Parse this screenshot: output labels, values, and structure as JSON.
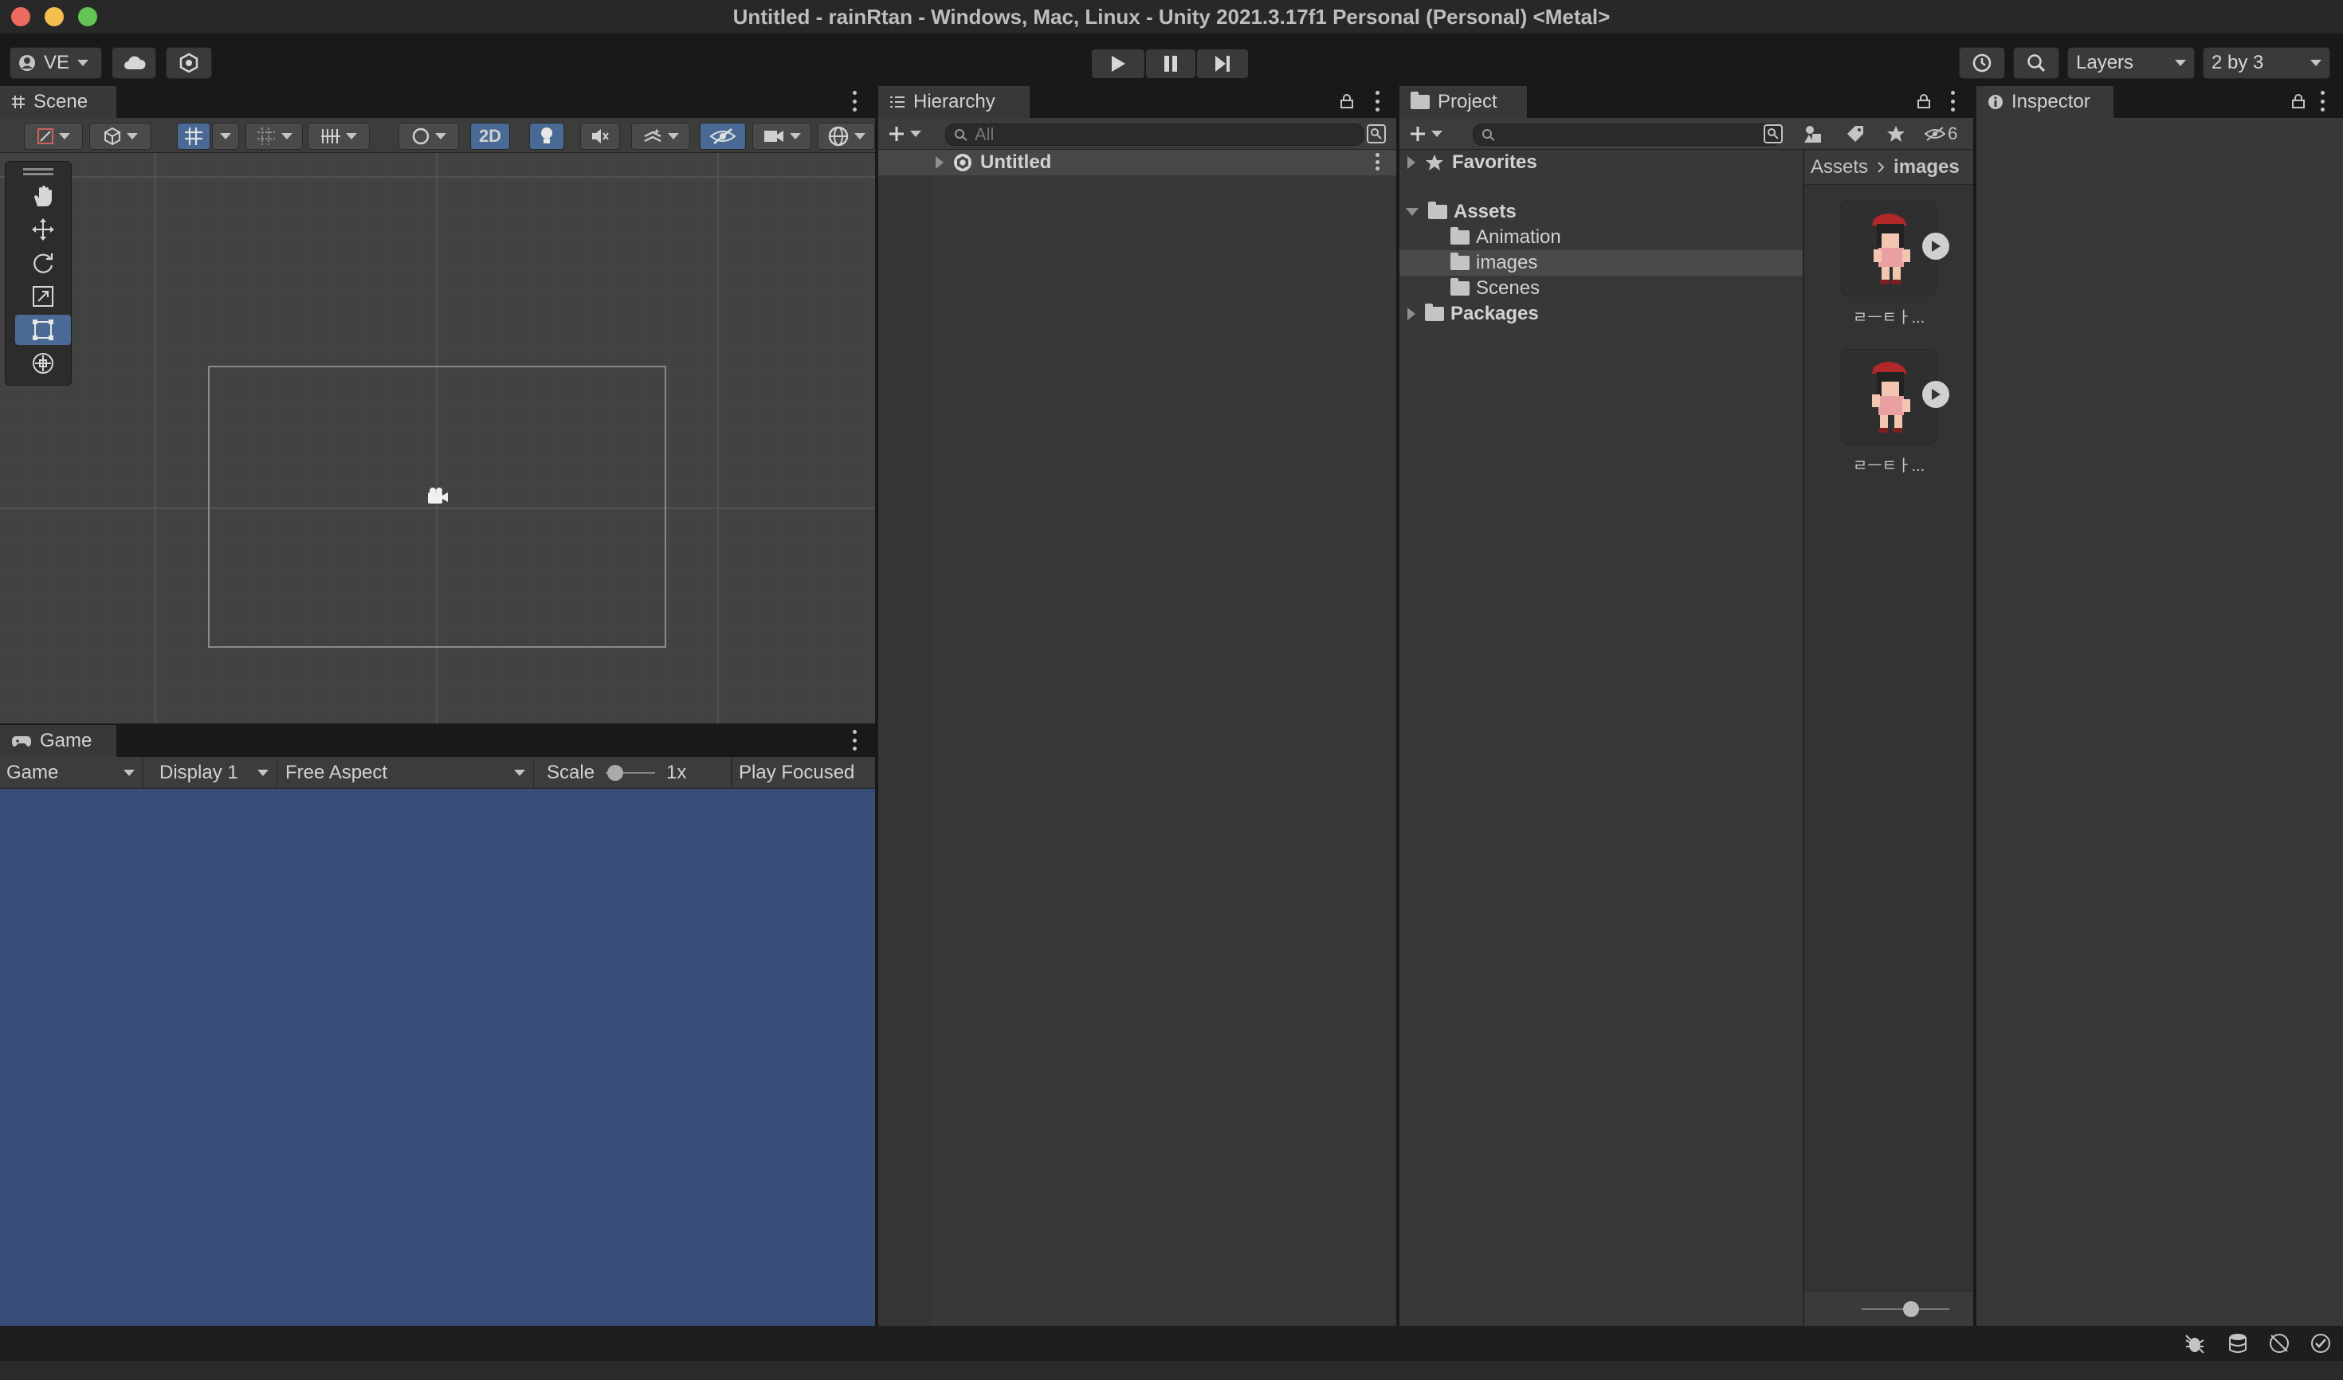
{
  "window": {
    "title": "Untitled - rainRtan - Windows, Mac, Linux - Unity 2021.3.17f1 Personal (Personal) <Metal>"
  },
  "toolbar": {
    "account_label": "VE",
    "layers_label": "Layers",
    "layout_label": "2 by 3"
  },
  "scene": {
    "tab_label": "Scene",
    "mode_2d_label": "2D"
  },
  "game": {
    "tab_label": "Game",
    "view_select": "Game",
    "display_select": "Display 1",
    "aspect_select": "Free Aspect",
    "scale_label": "Scale",
    "scale_value": "1x",
    "play_focused_label": "Play Focused"
  },
  "hierarchy": {
    "tab_label": "Hierarchy",
    "search_placeholder": "All",
    "scene_name": "Untitled"
  },
  "project": {
    "tab_label": "Project",
    "hidden_count": "6",
    "favorites_label": "Favorites",
    "assets_label": "Assets",
    "asset_folders": [
      "Animation",
      "images",
      "Scenes"
    ],
    "packages_label": "Packages",
    "breadcrumb": [
      "Assets",
      "images"
    ],
    "items": [
      {
        "label": "ㄹㅡㅌㅏ..."
      },
      {
        "label": "ㄹㅡㅌㅏ..."
      }
    ]
  },
  "inspector": {
    "tab_label": "Inspector"
  },
  "colors": {
    "accent_blue": "#4a6a96",
    "game_view_bg": "#384d78",
    "panel_bg": "#383838"
  }
}
